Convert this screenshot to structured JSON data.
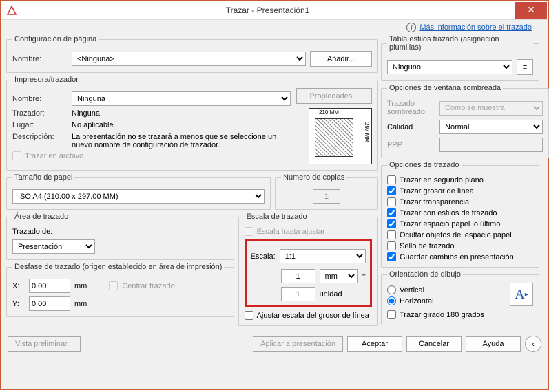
{
  "window": {
    "title": "Trazar - Presentación1"
  },
  "link": {
    "text": "Más información sobre el trazado"
  },
  "page_config": {
    "legend": "Configuración de página",
    "name_label": "Nombre:",
    "name_value": "<Ninguna>",
    "add_button": "Añadir..."
  },
  "printer": {
    "legend": "Impresora/trazador",
    "name_label": "Nombre:",
    "name_value": "Ninguna",
    "properties_button": "Propiedades...",
    "plotter_label": "Trazador:",
    "plotter_value": "Ninguna",
    "place_label": "Lugar:",
    "place_value": "No aplicable",
    "desc_label": "Descripción:",
    "desc_value": "La presentación no se trazará a menos que se seleccione un nuevo nombre de configuración de trazador.",
    "to_file": "Trazar en archivo",
    "preview_top": "210 MM",
    "preview_side": "297 MM"
  },
  "paper": {
    "legend": "Tamaño de papel",
    "value": "ISO A4 (210.00 x 297.00 MM)"
  },
  "copies": {
    "legend": "Número de copias",
    "value": "1"
  },
  "area": {
    "legend": "Área de trazado",
    "label": "Trazado de:",
    "value": "Presentación"
  },
  "scale": {
    "legend": "Escala de trazado",
    "fit": "Escala hasta ajustar",
    "label": "Escala:",
    "value": "1:1",
    "num": "1",
    "unit": "mm",
    "den": "1",
    "den_unit": "unidad",
    "lineweight": "Ajustar escala del grosor de línea"
  },
  "offset": {
    "legend": "Desfase de trazado (origen establecido en área de impresión)",
    "x_label": "X:",
    "x_value": "0.00",
    "y_label": "Y:",
    "y_value": "0.00",
    "unit": "mm",
    "center": "Centrar trazado"
  },
  "styles": {
    "legend": "Tabla estilos trazado (asignación plumillas)",
    "value": "Ninguno"
  },
  "shaded": {
    "legend": "Opciones de ventana sombreada",
    "shade_label": "Trazado sombreado",
    "shade_value": "Como se muestra",
    "quality_label": "Calidad",
    "quality_value": "Normal",
    "ppp_label": "PPP"
  },
  "options": {
    "legend": "Opciones de trazado",
    "bg": "Trazar en segundo plano",
    "lw": "Trazar grosor de línea",
    "tr": "Trazar transparencia",
    "st": "Trazar con estilos de trazado",
    "ps": "Trazar espacio papel lo último",
    "hide": "Ocultar objetos del espacio papel",
    "stamp": "Sello de trazado",
    "save": "Guardar cambios en presentación"
  },
  "orient": {
    "legend": "Orientación de dibujo",
    "v": "Vertical",
    "h": "Horizontal",
    "upside": "Trazar girado 180 grados",
    "glyph": "A"
  },
  "footer": {
    "preview": "Vista preliminar...",
    "apply": "Aplicar a presentación",
    "ok": "Aceptar",
    "cancel": "Cancelar",
    "help": "Ayuda"
  }
}
